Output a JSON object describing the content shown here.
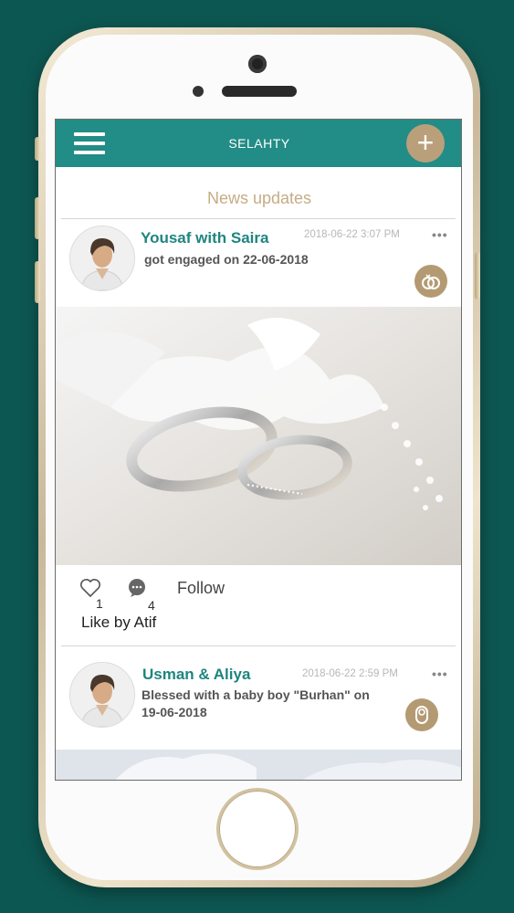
{
  "app": {
    "title": "SELAHTY"
  },
  "section_title": "News updates",
  "posts": [
    {
      "name": "Yousaf with Saira",
      "text_line1": "got engaged  on 22-06-2018",
      "text_line2": "",
      "time": "2018-06-22 3:07 PM",
      "more": "•••",
      "badge_icon": "rings-icon",
      "likes": "1",
      "comments": "4",
      "follow_label": "Follow",
      "liked_by": "Like by Atif"
    },
    {
      "name": "Usman & Aliya",
      "text_line1": "Blessed with a baby boy  \"Burhan\" on",
      "text_line2": "19-06-2018",
      "time": "2018-06-22 2:59 PM",
      "more": "•••",
      "badge_icon": "baby-icon"
    }
  ],
  "colors": {
    "primary": "#228c86",
    "accent": "#b9a07a",
    "background": "#0d5752"
  }
}
